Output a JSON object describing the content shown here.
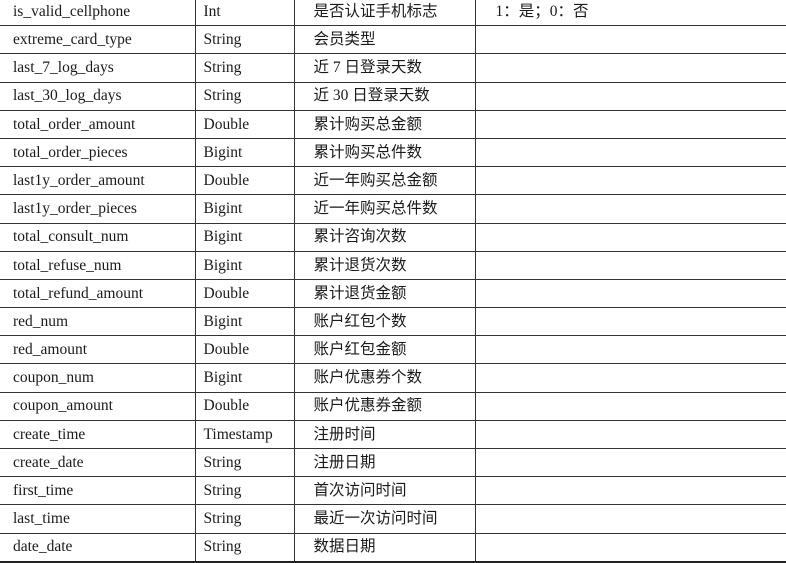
{
  "table": {
    "rows": [
      {
        "name": "is_valid_cellphone",
        "type": "Int",
        "desc": "是否认证手机标志",
        "note": "1：是；0：否"
      },
      {
        "name": "extreme_card_type",
        "type": "String",
        "desc": "会员类型",
        "note": ""
      },
      {
        "name": "last_7_log_days",
        "type": "String",
        "desc": "近 7 日登录天数",
        "note": ""
      },
      {
        "name": "last_30_log_days",
        "type": "String",
        "desc": "近 30 日登录天数",
        "note": ""
      },
      {
        "name": "total_order_amount",
        "type": "Double",
        "desc": "累计购买总金额",
        "note": ""
      },
      {
        "name": "total_order_pieces",
        "type": "Bigint",
        "desc": "累计购买总件数",
        "note": ""
      },
      {
        "name": "last1y_order_amount",
        "type": "Double",
        "desc": "近一年购买总金额",
        "note": ""
      },
      {
        "name": "last1y_order_pieces",
        "type": "Bigint",
        "desc": "近一年购买总件数",
        "note": ""
      },
      {
        "name": "total_consult_num",
        "type": "Bigint",
        "desc": "累计咨询次数",
        "note": ""
      },
      {
        "name": "total_refuse_num",
        "type": "Bigint",
        "desc": "累计退货次数",
        "note": ""
      },
      {
        "name": "total_refund_amount",
        "type": "Double",
        "desc": "累计退货金额",
        "note": ""
      },
      {
        "name": "red_num",
        "type": "Bigint",
        "desc": "账户红包个数",
        "note": ""
      },
      {
        "name": "red_amount",
        "type": "Double",
        "desc": "账户红包金额",
        "note": ""
      },
      {
        "name": "coupon_num",
        "type": "Bigint",
        "desc": "账户优惠券个数",
        "note": ""
      },
      {
        "name": "coupon_amount",
        "type": "Double",
        "desc": "账户优惠券金额",
        "note": ""
      },
      {
        "name": "create_time",
        "type": "Timestamp",
        "desc": "注册时间",
        "note": ""
      },
      {
        "name": "create_date",
        "type": "String",
        "desc": "注册日期",
        "note": ""
      },
      {
        "name": "first_time",
        "type": "String",
        "desc": "首次访问时间",
        "note": ""
      },
      {
        "name": "last_time",
        "type": "String",
        "desc": "最近一次访问时间",
        "note": ""
      },
      {
        "name": "date_date",
        "type": "String",
        "desc": "数据日期",
        "note": ""
      }
    ]
  }
}
